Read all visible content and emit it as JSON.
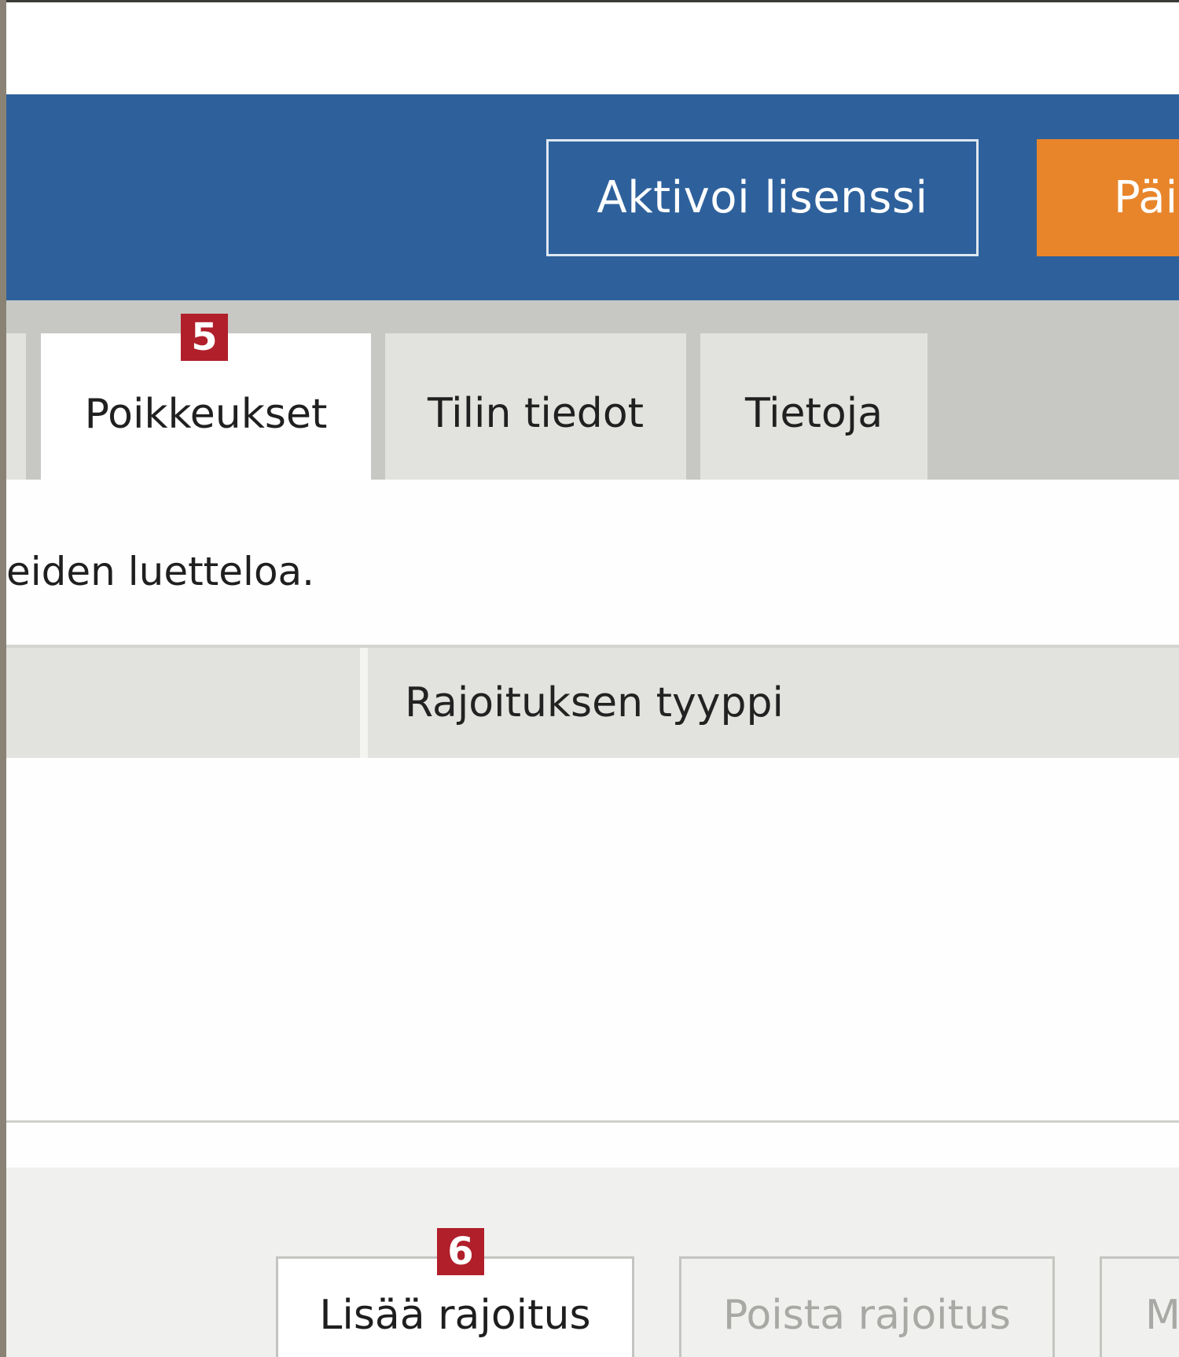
{
  "header": {
    "activate_label": "Aktivoi lisenssi",
    "update_label": "Päi"
  },
  "tabs": [
    {
      "label": ""
    },
    {
      "label": "Poikkeukset"
    },
    {
      "label": "Tilin tiedot"
    },
    {
      "label": "Tietoja"
    }
  ],
  "annotations": {
    "tab_marker": "5",
    "button_marker": "6"
  },
  "content": {
    "intro_text": "eiden luetteloa."
  },
  "table": {
    "columns": [
      "",
      "Rajoituksen tyyppi"
    ]
  },
  "footer": {
    "add_label": "Lisää rajoitus",
    "remove_label": "Poista rajoitus",
    "more_label": "M"
  },
  "colors": {
    "header_bg": "#2e619c",
    "accent_orange": "#e8852b",
    "marker_red": "#b01f2a"
  }
}
